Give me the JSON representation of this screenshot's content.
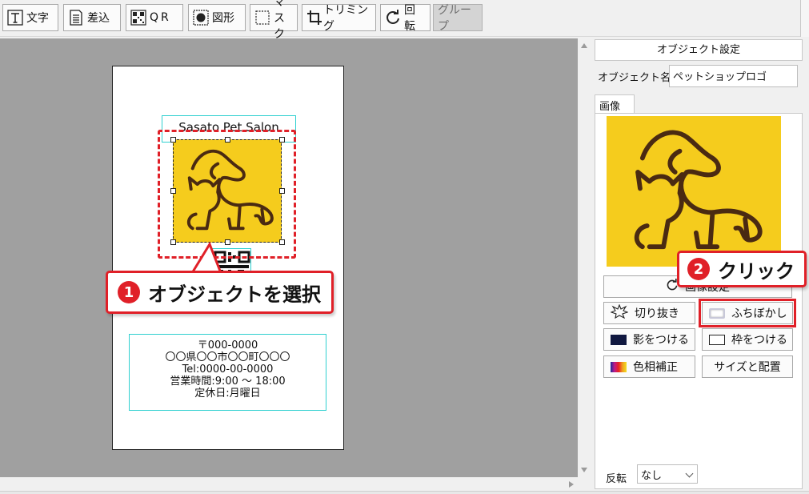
{
  "toolbar": {
    "text": "文字",
    "merge": "差込",
    "qr": "QR",
    "shape": "図形",
    "mask": "マスク",
    "trim": "トリミング",
    "rotate": "回転",
    "group": "グループ"
  },
  "card": {
    "title": "Sasato Pet Salon",
    "address": {
      "line1": "〒000-0000",
      "line2": "〇〇県〇〇市〇〇町〇〇〇",
      "line3": "Tel:0000-00-0000",
      "line4": "営業時間:9:00 ～ 18:00",
      "line5": "定休日:月曜日"
    }
  },
  "callouts": {
    "select": {
      "num": "1",
      "text": "オブジェクトを選択"
    },
    "click": {
      "num": "2",
      "text": "クリック"
    }
  },
  "panel": {
    "header": "オブジェクト設定",
    "object_name_label": "オブジェクト名",
    "object_name_value": "ペットショップロゴ",
    "tab_image": "画像",
    "btn_original": "画像設定",
    "btn_cutout": "切り抜き",
    "btn_blur": "ふちぼかし",
    "btn_shadow": "影をつける",
    "btn_frame": "枠をつける",
    "btn_color": "色相補正",
    "btn_size": "サイズと配置",
    "flip_label": "反転",
    "flip_value": "なし"
  },
  "colors": {
    "accent": "#e02028",
    "logo_bg": "#f5cc1d",
    "logo_line": "#4a2a12",
    "guide": "#2fd0d0",
    "canvas": "#a0a0a0"
  }
}
